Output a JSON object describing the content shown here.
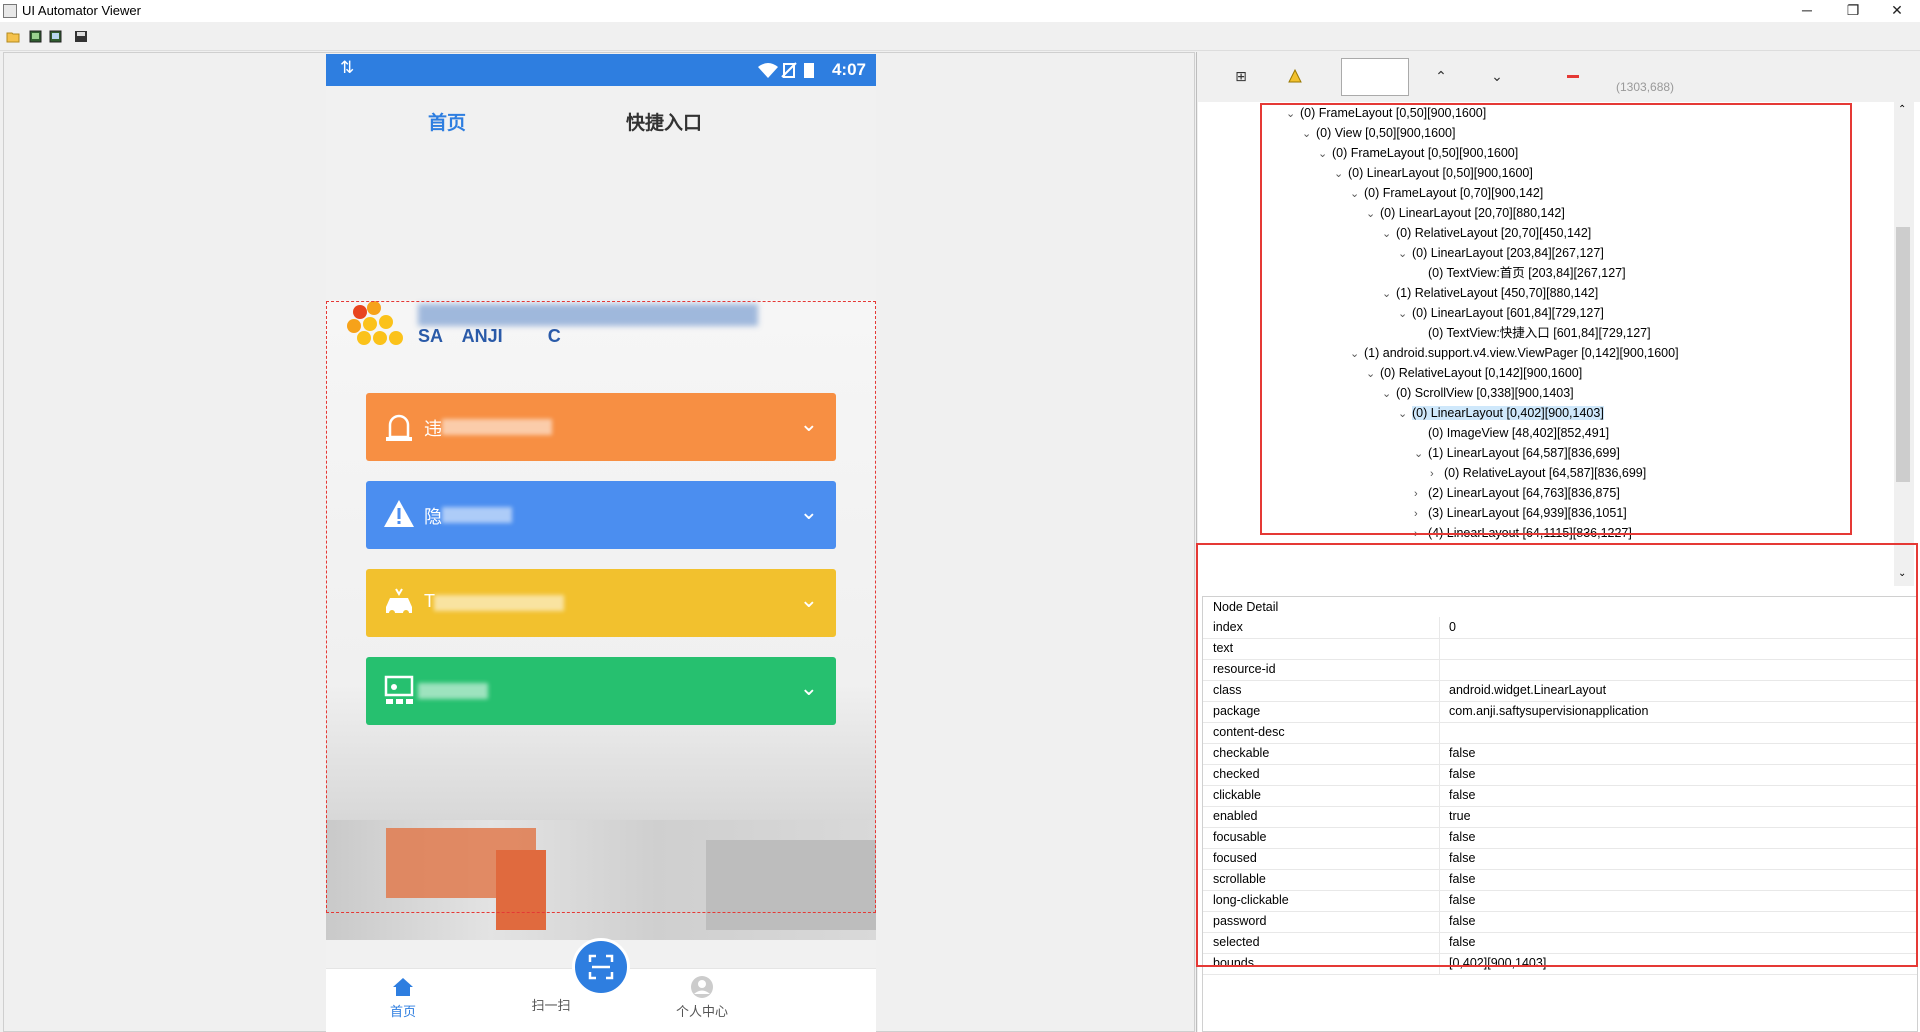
{
  "window": {
    "title": "UI Automator Viewer",
    "controls": [
      "─",
      "❐",
      "✕"
    ]
  },
  "toolbar": {
    "icons": [
      "open-folder-icon",
      "device-screenshot-icon",
      "device-screenshot-compressed-icon",
      "save-icon"
    ]
  },
  "phone": {
    "status_time": "4:07",
    "status_arrows": "⇅",
    "tabs": [
      "首页",
      "快捷入口"
    ],
    "cards": [
      {
        "label": "违",
        "color": "#f78f43",
        "icon": "alarm-light-icon"
      },
      {
        "label": "隐",
        "color": "#4b8ef0",
        "icon": "warning-icon"
      },
      {
        "label": "T",
        "color": "#f2c12e",
        "icon": "car-icon"
      },
      {
        "label": "",
        "color": "#26c06f",
        "icon": "presentation-icon"
      }
    ],
    "logo_text": "SA    ANJI         C",
    "bottom_nav": [
      "首页",
      "扫一扫",
      "个人中心"
    ]
  },
  "viewer_toolbar": {
    "coords": "(1303,688)",
    "icons": [
      "expand-all-icon",
      "warning-icon",
      "up-icon",
      "down-icon",
      "red-minus-icon"
    ]
  },
  "tree": [
    {
      "depth": 0,
      "tw": "v",
      "label": "(0) FrameLayout [0,50][900,1600]"
    },
    {
      "depth": 1,
      "tw": "v",
      "label": "(0) View [0,50][900,1600]"
    },
    {
      "depth": 2,
      "tw": "v",
      "label": "(0) FrameLayout [0,50][900,1600]"
    },
    {
      "depth": 3,
      "tw": "v",
      "label": "(0) LinearLayout [0,50][900,1600]"
    },
    {
      "depth": 4,
      "tw": "v",
      "label": "(0) FrameLayout [0,70][900,142]"
    },
    {
      "depth": 5,
      "tw": "v",
      "label": "(0) LinearLayout [20,70][880,142]"
    },
    {
      "depth": 6,
      "tw": "v",
      "label": "(0) RelativeLayout [20,70][450,142]"
    },
    {
      "depth": 7,
      "tw": "v",
      "label": "(0) LinearLayout [203,84][267,127]"
    },
    {
      "depth": 8,
      "tw": "",
      "label": "(0) TextView:首页 [203,84][267,127]"
    },
    {
      "depth": 6,
      "tw": "v",
      "label": "(1) RelativeLayout [450,70][880,142]"
    },
    {
      "depth": 7,
      "tw": "v",
      "label": "(0) LinearLayout [601,84][729,127]"
    },
    {
      "depth": 8,
      "tw": "",
      "label": "(0) TextView:快捷入口 [601,84][729,127]"
    },
    {
      "depth": 4,
      "tw": "v",
      "label": "(1) android.support.v4.view.ViewPager [0,142][900,1600]"
    },
    {
      "depth": 5,
      "tw": "v",
      "label": "(0) RelativeLayout [0,142][900,1600]"
    },
    {
      "depth": 6,
      "tw": "v",
      "label": "(0) ScrollView [0,338][900,1403]"
    },
    {
      "depth": 7,
      "tw": "v",
      "label": "(0) LinearLayout [0,402][900,1403]",
      "selected": true
    },
    {
      "depth": 8,
      "tw": "",
      "label": "(0) ImageView [48,402][852,491]"
    },
    {
      "depth": 8,
      "tw": "v",
      "label": "(1) LinearLayout [64,587][836,699]"
    },
    {
      "depth": 9,
      "tw": ">",
      "label": "(0) RelativeLayout [64,587][836,699]"
    },
    {
      "depth": 8,
      "tw": ">",
      "label": "(2) LinearLayout [64,763][836,875]"
    },
    {
      "depth": 8,
      "tw": ">",
      "label": "(3) LinearLayout [64,939][836,1051]"
    },
    {
      "depth": 8,
      "tw": ">",
      "label": "(4) LinearLayout [64,1115][836,1227]"
    }
  ],
  "detail": {
    "title": "Node Detail",
    "rows": [
      {
        "k": "index",
        "v": "0"
      },
      {
        "k": "text",
        "v": ""
      },
      {
        "k": "resource-id",
        "v": ""
      },
      {
        "k": "class",
        "v": "android.widget.LinearLayout"
      },
      {
        "k": "package",
        "v": "com.anji.saftysupervisionapplication"
      },
      {
        "k": "content-desc",
        "v": ""
      },
      {
        "k": "checkable",
        "v": "false"
      },
      {
        "k": "checked",
        "v": "false"
      },
      {
        "k": "clickable",
        "v": "false"
      },
      {
        "k": "enabled",
        "v": "true"
      },
      {
        "k": "focusable",
        "v": "false"
      },
      {
        "k": "focused",
        "v": "false"
      },
      {
        "k": "scrollable",
        "v": "false"
      },
      {
        "k": "long-clickable",
        "v": "false"
      },
      {
        "k": "password",
        "v": "false"
      },
      {
        "k": "selected",
        "v": "false"
      },
      {
        "k": "bounds",
        "v": "[0,402][900,1403]"
      }
    ]
  }
}
